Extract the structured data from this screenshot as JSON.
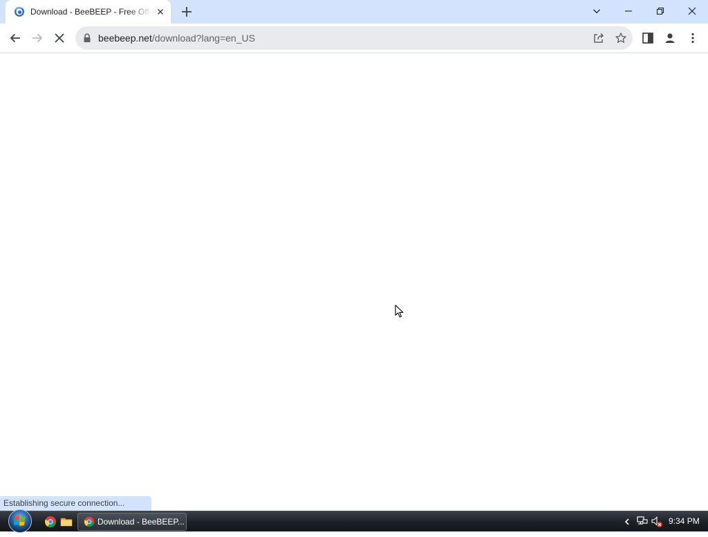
{
  "browser": {
    "tab": {
      "title": "Download - BeeBEEP - Free Office Messenger",
      "favicon": "beebeep-logo-icon"
    },
    "window_controls": [
      "tab-search",
      "minimize",
      "restore",
      "close"
    ],
    "address_bar": {
      "host": "beebeep.net",
      "path": "/download?lang=en_US"
    },
    "loading": true,
    "status_bubble": "Establishing secure connection..."
  },
  "taskbar": {
    "quick_launch": [
      "chrome-icon",
      "folder-icon"
    ],
    "active_window_label": "Download - BeeBEEP...",
    "clock": "9:34 PM"
  },
  "colors": {
    "titlebar_bg": "#d3e3fd",
    "omnibox_bg": "#e8eaed",
    "taskbar_bg": "#1c1f24"
  }
}
